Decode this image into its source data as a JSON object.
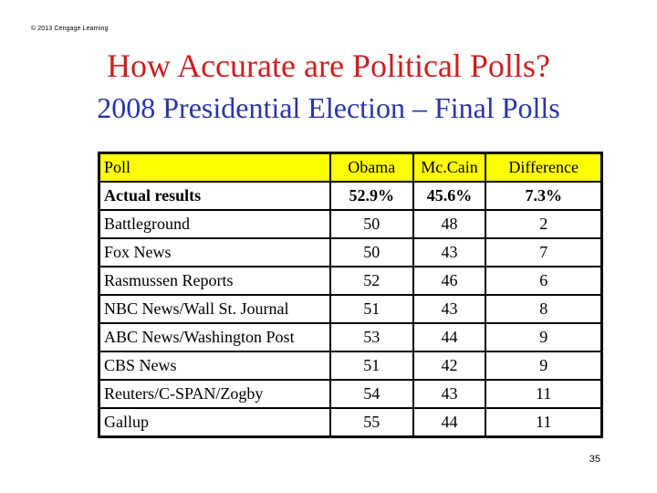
{
  "copyright": "© 2013 Cengage Learning",
  "title": "How Accurate are Political Polls?",
  "subtitle": "2008 Presidential Election – Final Polls",
  "colors": {
    "title": "#cc1f1f",
    "subtitle": "#2b35a8",
    "header_background": "#ffff00"
  },
  "table": {
    "headers": [
      "Poll",
      "Obama",
      "Mc.Cain",
      "Difference"
    ],
    "actual": {
      "poll": "Actual results",
      "obama": "52.9%",
      "mccain": "45.6%",
      "difference": "7.3%"
    },
    "rows": [
      {
        "poll": "Battleground",
        "obama": "50",
        "mccain": "48",
        "difference": "2"
      },
      {
        "poll": "Fox News",
        "obama": "50",
        "mccain": "43",
        "difference": "7"
      },
      {
        "poll": "Rasmussen Reports",
        "obama": "52",
        "mccain": "46",
        "difference": "6"
      },
      {
        "poll": "NBC News/Wall St. Journal",
        "obama": "51",
        "mccain": "43",
        "difference": "8"
      },
      {
        "poll": "ABC News/Washington Post",
        "obama": "53",
        "mccain": "44",
        "difference": "9"
      },
      {
        "poll": "CBS News",
        "obama": "51",
        "mccain": "42",
        "difference": "9"
      },
      {
        "poll": "Reuters/C-SPAN/Zogby",
        "obama": "54",
        "mccain": "43",
        "difference": "11"
      },
      {
        "poll": "Gallup",
        "obama": "55",
        "mccain": "44",
        "difference": "11"
      }
    ]
  },
  "page_number": "35"
}
